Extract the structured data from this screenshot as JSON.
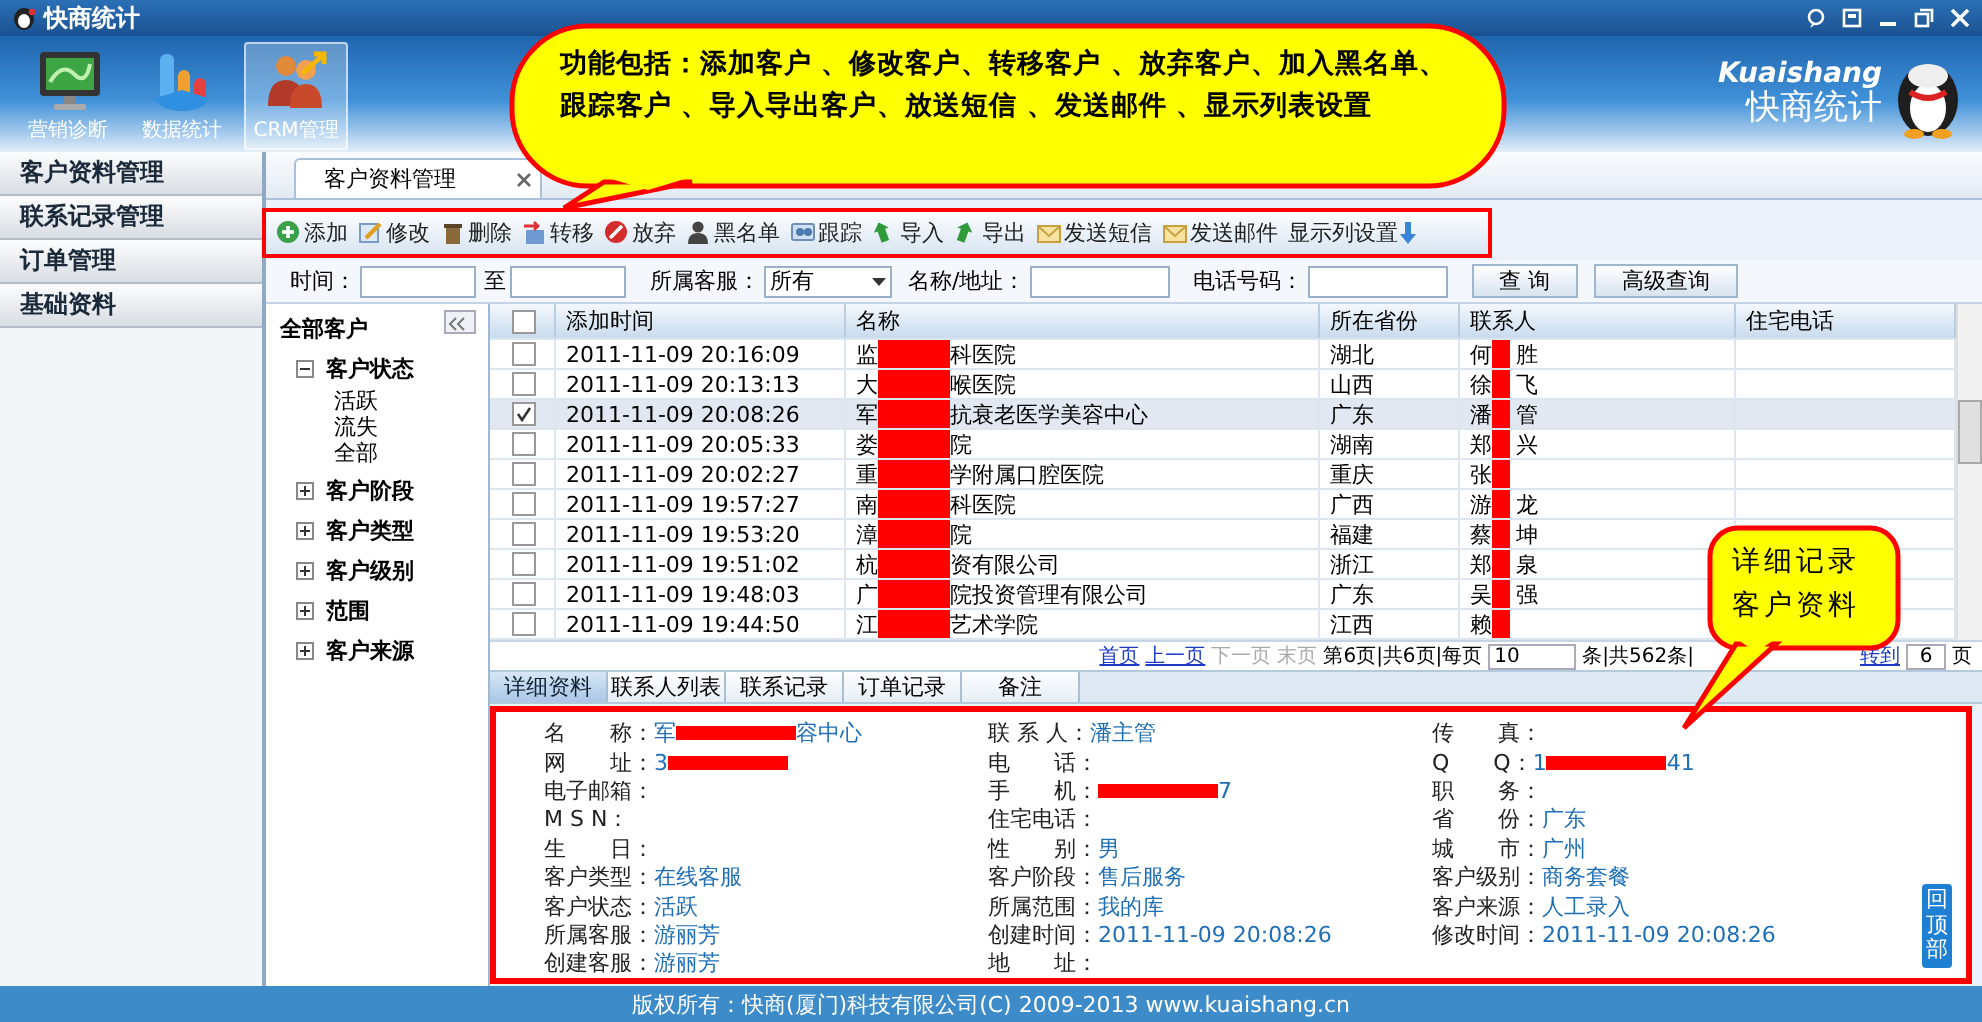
{
  "window": {
    "title": "快商统计"
  },
  "nav": [
    {
      "label": "营销诊断",
      "selected": false
    },
    {
      "label": "数据统计",
      "selected": false
    },
    {
      "label": "CRM管理",
      "selected": true
    }
  ],
  "brand": {
    "name": "Kuaishang",
    "subtitle": "快商统计"
  },
  "sidebar": {
    "items": [
      "客户资料管理",
      "联系记录管理",
      "订单管理",
      "基础资料"
    ]
  },
  "page_tabs": [
    {
      "label": "客户资料管理",
      "closable": true
    }
  ],
  "toolbar": {
    "buttons": [
      "添加",
      "修改",
      "删除",
      "转移",
      "放弃",
      "黑名单",
      "跟踪",
      "导入",
      "导出",
      "发送短信",
      "发送邮件",
      "显示列设置"
    ]
  },
  "filters": {
    "time_label": "时间：",
    "to_label": "至",
    "agent_label": "所属客服：",
    "agent_value": "所有",
    "name_label": "名称/地址：",
    "phone_label": "电话号码：",
    "buttons": [
      "查 询",
      "高级查询"
    ]
  },
  "tree": {
    "root": "全部客户",
    "children": [
      {
        "label": "客户状态",
        "expanded": true,
        "children": [
          {
            "label": "活跃"
          },
          {
            "label": "流失"
          },
          {
            "label": "全部"
          }
        ]
      },
      {
        "label": "客户阶段",
        "expanded": false
      },
      {
        "label": "客户类型",
        "expanded": false
      },
      {
        "label": "客户级别",
        "expanded": false
      },
      {
        "label": "范围",
        "expanded": false
      },
      {
        "label": "客户来源",
        "expanded": false
      }
    ]
  },
  "grid": {
    "header_checked": false,
    "columns": [
      "添加时间",
      "名称",
      "所在省份",
      "联系人",
      "住宅电话"
    ],
    "rows": [
      {
        "checked": false,
        "redacted": true,
        "time": "2011-11-09 20:16:09",
        "name_start": "监",
        "name_end": "科医院",
        "province": "湖北",
        "contact_start": "何",
        "contact_end": "胜"
      },
      {
        "checked": false,
        "redacted": true,
        "time": "2011-11-09 20:13:13",
        "name_start": "大",
        "name_end": "喉医院",
        "province": "山西",
        "contact_start": "徐",
        "contact_end": "飞"
      },
      {
        "checked": true,
        "redacted": true,
        "time": "2011-11-09 20:08:26",
        "name_start": "军",
        "name_end": "抗衰老医学美容中心",
        "province": "广东",
        "contact_start": "潘",
        "contact_end": "管"
      },
      {
        "checked": false,
        "redacted": true,
        "time": "2011-11-09 20:05:33",
        "name_start": "娄",
        "name_end": "院",
        "province": "湖南",
        "contact_start": "郑",
        "contact_end": "兴"
      },
      {
        "checked": false,
        "redacted": true,
        "time": "2011-11-09 20:02:27",
        "name_start": "重",
        "name_end": "学附属口腔医院",
        "province": "重庆",
        "contact_start": "张"
      },
      {
        "checked": false,
        "redacted": true,
        "time": "2011-11-09 19:57:27",
        "name_start": "南",
        "name_end": "科医院",
        "province": "广西",
        "contact_start": "游",
        "contact_end": "龙"
      },
      {
        "checked": false,
        "redacted": true,
        "time": "2011-11-09 19:53:20",
        "name_start": "漳",
        "name_end": "院",
        "province": "福建",
        "contact_start": "蔡",
        "contact_end": "坤"
      },
      {
        "checked": false,
        "redacted": true,
        "time": "2011-11-09 19:51:02",
        "name_start": "杭",
        "name_end": "资有限公司",
        "province": "浙江",
        "contact_start": "郑",
        "contact_end": "泉"
      },
      {
        "checked": false,
        "redacted": true,
        "time": "2011-11-09 19:48:03",
        "name_start": "广",
        "name_end": "院投资管理有限公司",
        "province": "广东",
        "contact_start": "吴",
        "contact_end": "强"
      },
      {
        "checked": false,
        "redacted": true,
        "time": "2011-11-09 19:44:50",
        "name_start": "江",
        "name_end": "艺术学院",
        "province": "江西",
        "contact_start": "赖"
      }
    ]
  },
  "pager": {
    "links": [
      {
        "label": "首页",
        "disabled": false
      },
      {
        "label": "上一页",
        "disabled": false
      },
      {
        "label": "下一页",
        "disabled": true
      },
      {
        "label": "末页",
        "disabled": true
      }
    ],
    "summary": "第6页|共6页|每页",
    "page_size": "10",
    "total": "条|共562条|",
    "goto": "转到",
    "page": "6",
    "page_suffix": "页"
  },
  "detail_tabs": [
    {
      "label": "详细资料",
      "selected": true
    },
    {
      "label": "联系人列表",
      "selected": false
    },
    {
      "label": "联系记录",
      "selected": false
    },
    {
      "label": "订单记录",
      "selected": false
    },
    {
      "label": "备注",
      "selected": false
    }
  ],
  "detail": {
    "columns": [
      [
        {
          "label": "名　　称：",
          "value": "军",
          "redacted": true,
          "value_end": "容中心"
        },
        {
          "label": "网　　址：",
          "value": "3",
          "redacted": true
        },
        {
          "label": "电子邮箱："
        },
        {
          "label": "M S N："
        },
        {
          "label": "生　　日："
        },
        {
          "label": "客户类型：",
          "value": "在线客服"
        },
        {
          "label": "客户状态：",
          "value": "活跃"
        },
        {
          "label": "所属客服：",
          "value": "游丽芳"
        },
        {
          "label": "创建客服：",
          "value": "游丽芳"
        }
      ],
      [
        {
          "label": "联 系 人：",
          "value": "潘主管"
        },
        {
          "label": "电　　话："
        },
        {
          "label": "手　　机：",
          "redacted": true,
          "value_end": "7"
        },
        {
          "label": "住宅电话："
        },
        {
          "label": "性　　别：",
          "value": "男"
        },
        {
          "label": "客户阶段：",
          "value": "售后服务"
        },
        {
          "label": "所属范围：",
          "value": "我的库"
        },
        {
          "label": "创建时间：",
          "value": "2011-11-09 20:08:26"
        },
        {
          "label": "地　　址："
        }
      ],
      [
        {
          "label": "传　　真："
        },
        {
          "label": "Q　　Q：",
          "value": "1",
          "redacted": true,
          "value_end": "41"
        },
        {
          "label": "职　　务："
        },
        {
          "label": "省　　份：",
          "value": "广东"
        },
        {
          "label": "城　　市：",
          "value": "广州"
        },
        {
          "label": "客户级别：",
          "value": "商务套餐"
        },
        {
          "label": "客户来源：",
          "value": "人工录入"
        },
        {
          "label": "修改时间：",
          "value": "2011-11-09 20:08:26"
        }
      ]
    ]
  },
  "back_to_top": "回顶部",
  "footer": {
    "copyright": "版权所有：快商(厦门)科技有限公司(C) 2009-2013 www.kuaishang.cn"
  },
  "callouts": [
    {
      "lines": [
        "功能包括：添加客户 、修改客户、转移客户 、放弃客户、加入黑名单、",
        "跟踪客户 、导入导出客户、放送短信 、发送邮件 、显示列表设置"
      ]
    },
    {
      "lines": [
        "详细记录",
        "客户资料"
      ]
    }
  ]
}
